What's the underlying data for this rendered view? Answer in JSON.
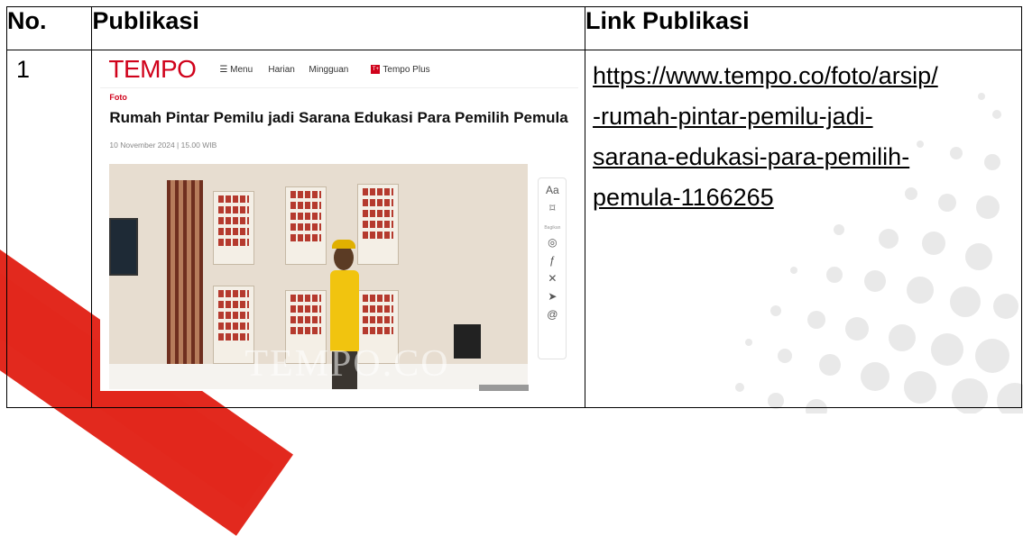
{
  "table": {
    "headers": {
      "no": "No.",
      "publikasi": "Publikasi",
      "link": "Link Publikasi"
    },
    "rows": [
      {
        "no": "1",
        "link_lines": [
          "https://www.tempo.co/foto/arsip/",
          "-rumah-pintar-pemilu-jadi-",
          "sarana-edukasi-para-pemilih-",
          "pemula-1166265"
        ]
      }
    ]
  },
  "screenshot": {
    "logo": "TEMPO",
    "nav": {
      "menu": "Menu",
      "harian": "Harian",
      "mingguan": "Mingguan",
      "tempo_plus_badge": "T+",
      "tempo_plus": "Tempo Plus"
    },
    "category": "Foto",
    "headline": "Rumah Pintar Pemilu jadi Sarana Edukasi Para Pemilih Pemula",
    "date": "10 November 2024 | 15.00 WIB",
    "watermark": "TEMPO.CO",
    "sidebar": {
      "font_size": "Aa",
      "share_label": "Bagikan"
    }
  },
  "colors": {
    "tempo_red": "#d0021b",
    "bg_red": "#e01e12"
  }
}
